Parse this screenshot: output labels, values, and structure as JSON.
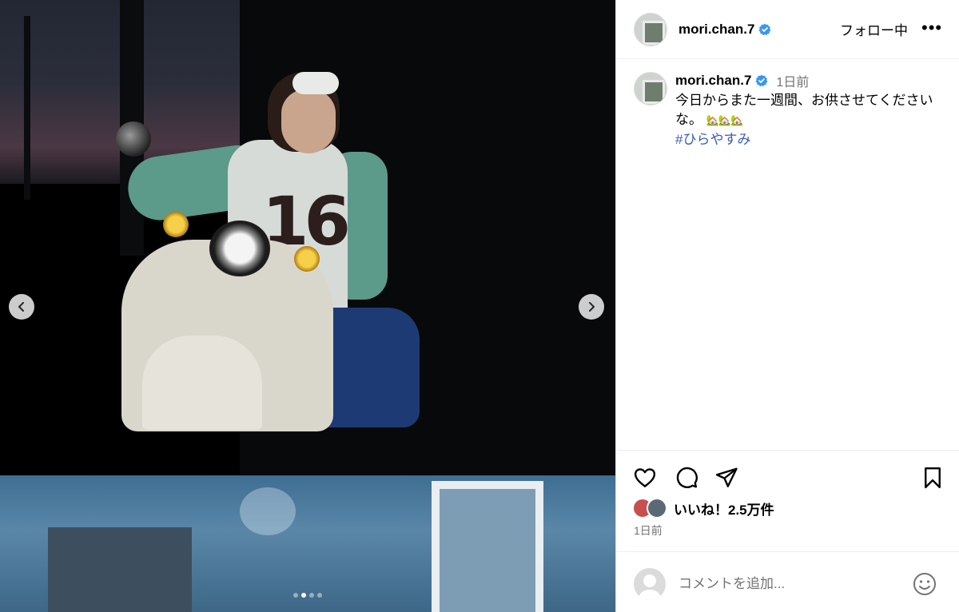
{
  "post": {
    "username": "mori.chan.7",
    "follow_label": "フォロー中",
    "more_label": "•••"
  },
  "caption": {
    "username": "mori.chan.7",
    "time_ago": "1日前",
    "text": "今日からまた一週間、お供させてくださいな。",
    "emojis": "🏡🏡🏡",
    "hashtag": "#ひらやすみ"
  },
  "carousel": {
    "slide_count": 4,
    "active_index": 1
  },
  "engagement": {
    "likes_label": "いいね！2.5万件",
    "date": "1日前"
  },
  "comment": {
    "placeholder": "コメントを追加..."
  },
  "colors": {
    "verified": "#3897f0",
    "hashtag": "#3b5db8",
    "muted": "#737373"
  },
  "icons": {
    "like": "heart-icon",
    "comment": "comment-icon",
    "share": "send-icon",
    "save": "bookmark-icon",
    "emoji": "smiley-icon",
    "prev": "chevron-left-icon",
    "next": "chevron-right-icon"
  }
}
